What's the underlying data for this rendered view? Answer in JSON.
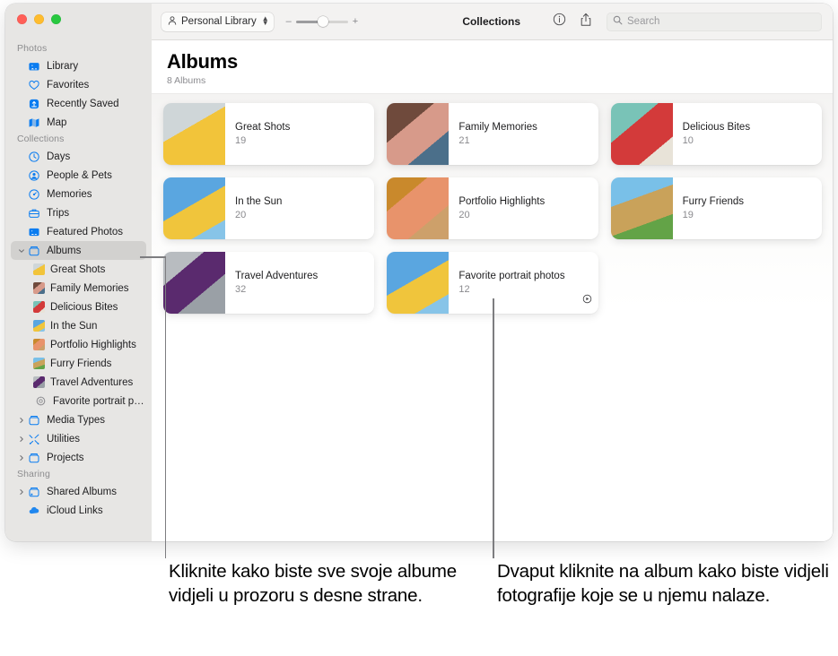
{
  "window": {
    "traffic_lights": [
      "close",
      "minimize",
      "zoom"
    ]
  },
  "toolbar": {
    "library_label": "Personal Library",
    "zoom_minus": "–",
    "zoom_plus": "+",
    "title": "Collections",
    "info_icon": "info-icon",
    "share_icon": "share-icon",
    "search_placeholder": "Search",
    "search_value": ""
  },
  "sidebar": {
    "sections": [
      {
        "header": "Photos",
        "items": [
          {
            "label": "Library",
            "icon": "library-icon",
            "type": "top",
            "chevron": false
          },
          {
            "label": "Favorites",
            "icon": "heart-icon",
            "type": "top",
            "chevron": false
          },
          {
            "label": "Recently Saved",
            "icon": "recently-saved-icon",
            "type": "top",
            "chevron": false
          },
          {
            "label": "Map",
            "icon": "map-icon",
            "type": "top",
            "chevron": false
          }
        ]
      },
      {
        "header": "Collections",
        "items": [
          {
            "label": "Days",
            "icon": "clock-icon",
            "type": "top",
            "chevron": false
          },
          {
            "label": "People & Pets",
            "icon": "people-icon",
            "type": "top",
            "chevron": false
          },
          {
            "label": "Memories",
            "icon": "memories-icon",
            "type": "top",
            "chevron": false
          },
          {
            "label": "Trips",
            "icon": "trips-icon",
            "type": "top",
            "chevron": false
          },
          {
            "label": "Featured Photos",
            "icon": "featured-photos-icon",
            "type": "top",
            "chevron": false
          },
          {
            "label": "Albums",
            "icon": "albums-icon",
            "type": "top",
            "chevron": true,
            "expanded": true,
            "selected": true
          },
          {
            "label": "Great Shots",
            "icon": "album-thumb",
            "thumb": "th-great",
            "type": "child"
          },
          {
            "label": "Family Memories",
            "icon": "album-thumb",
            "thumb": "th-family",
            "type": "child"
          },
          {
            "label": "Delicious Bites",
            "icon": "album-thumb",
            "thumb": "th-delic",
            "type": "child"
          },
          {
            "label": "In the Sun",
            "icon": "album-thumb",
            "thumb": "th-sun",
            "type": "child"
          },
          {
            "label": "Portfolio Highlights",
            "icon": "album-thumb",
            "thumb": "th-port",
            "type": "child"
          },
          {
            "label": "Furry Friends",
            "icon": "album-thumb",
            "thumb": "th-furry",
            "type": "child"
          },
          {
            "label": "Travel Adventures",
            "icon": "album-thumb",
            "thumb": "th-travel",
            "type": "child"
          },
          {
            "label": "Favorite portrait photos",
            "icon": "smart-album-icon",
            "type": "child"
          },
          {
            "label": "Media Types",
            "icon": "media-types-icon",
            "type": "top",
            "chevron": true,
            "expanded": false
          },
          {
            "label": "Utilities",
            "icon": "utilities-icon",
            "type": "top",
            "chevron": true,
            "expanded": false
          },
          {
            "label": "Projects",
            "icon": "projects-icon",
            "type": "top",
            "chevron": true,
            "expanded": false
          }
        ]
      },
      {
        "header": "Sharing",
        "items": [
          {
            "label": "Shared Albums",
            "icon": "shared-albums-icon",
            "type": "top",
            "chevron": true,
            "expanded": false
          },
          {
            "label": "iCloud Links",
            "icon": "icloud-links-icon",
            "type": "top",
            "chevron": false
          }
        ]
      }
    ]
  },
  "main": {
    "title": "Albums",
    "subtitle": "8 Albums",
    "albums": [
      {
        "title": "Great Shots",
        "count": "19",
        "thumb": "th-great",
        "badge": null
      },
      {
        "title": "Family Memories",
        "count": "21",
        "thumb": "th-family",
        "badge": null
      },
      {
        "title": "Delicious Bites",
        "count": "10",
        "thumb": "th-delic",
        "badge": null
      },
      {
        "title": "In the Sun",
        "count": "20",
        "thumb": "th-sun",
        "badge": null
      },
      {
        "title": "Portfolio Highlights",
        "count": "20",
        "thumb": "th-port",
        "badge": null
      },
      {
        "title": "Furry Friends",
        "count": "19",
        "thumb": "th-furry",
        "badge": null
      },
      {
        "title": "Travel Adventures",
        "count": "32",
        "thumb": "th-travel",
        "badge": null
      },
      {
        "title": "Favorite portrait photos",
        "count": "12",
        "thumb": "th-sun",
        "badge": "smart-album-badge-icon"
      }
    ]
  },
  "callouts": [
    {
      "text": "Kliknite kako biste sve svoje albume vidjeli u prozoru s desne strane."
    },
    {
      "text": "Dvaput kliknite na album kako biste vidjeli fotografije koje se u njemu nalaze."
    }
  ]
}
